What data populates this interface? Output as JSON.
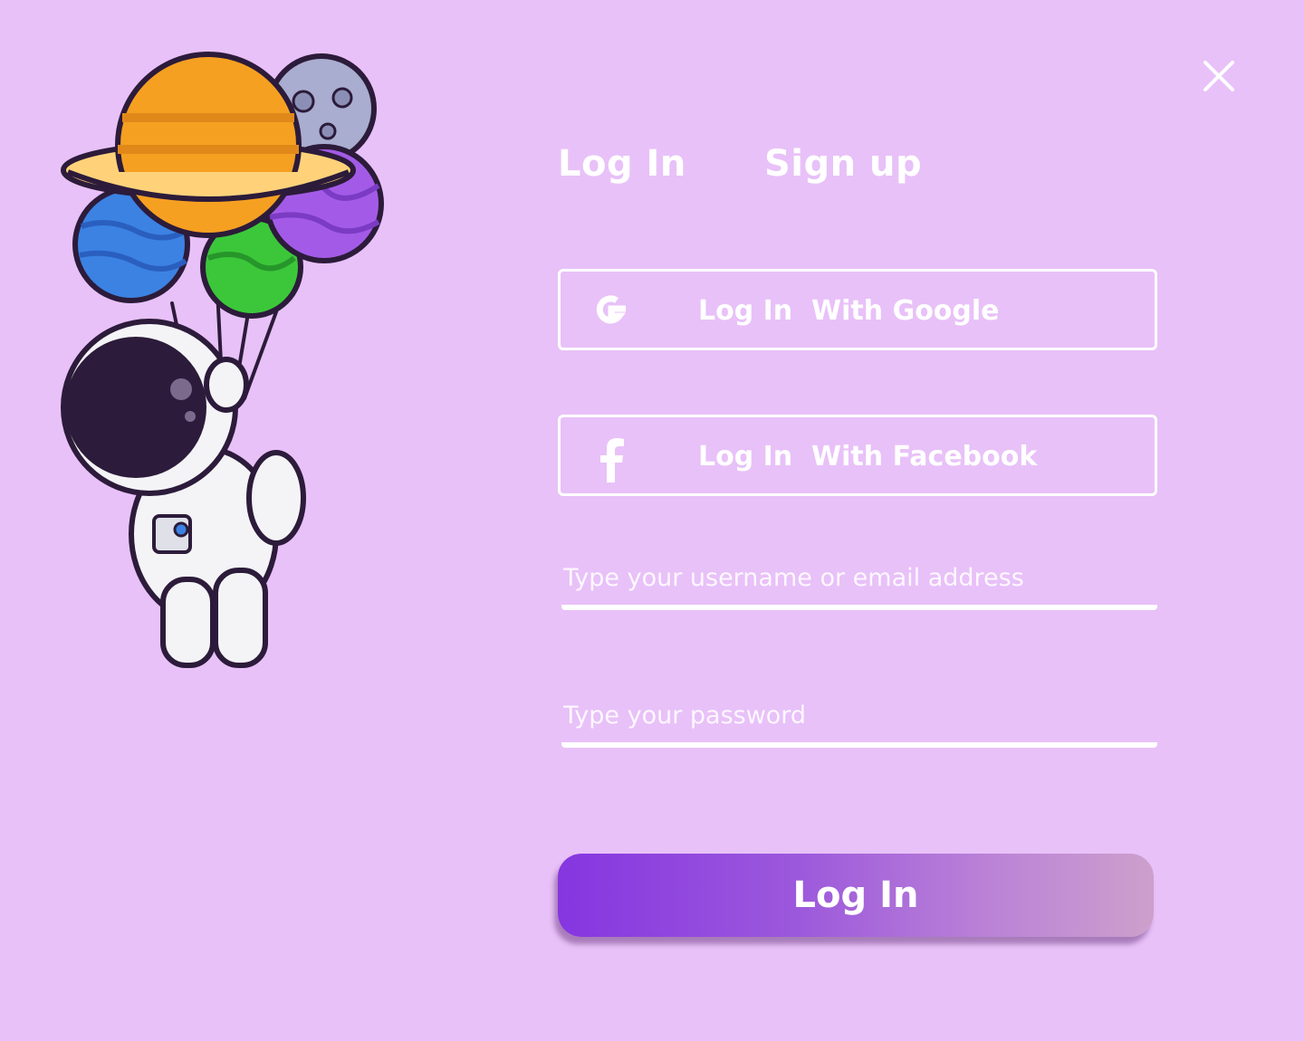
{
  "icons": {
    "close": "close-icon",
    "google": "google-icon",
    "facebook": "facebook-icon",
    "illustration": "astronaut-with-planet-balloons-illustration"
  },
  "colors": {
    "background": "#e8c1f8",
    "text": "#ffffff",
    "button_gradient_start": "#8536e0",
    "button_gradient_end": "#cca0cc"
  },
  "tabs": {
    "login": "Log In",
    "signup": "Sign up"
  },
  "social": {
    "google_label": "Log In  With Google",
    "facebook_label": "Log In  With Facebook"
  },
  "form": {
    "username_placeholder": "Type your username or email address",
    "username_value": "",
    "password_placeholder": "Type your password",
    "password_value": ""
  },
  "submit_label": "Log In"
}
